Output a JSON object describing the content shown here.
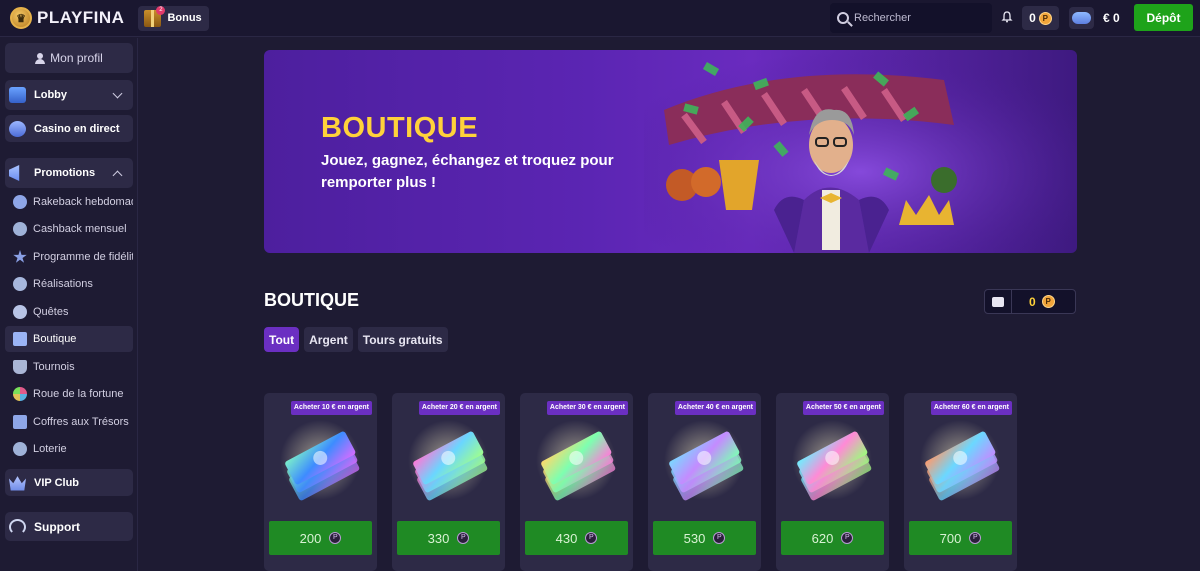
{
  "header": {
    "logo_text": "PLAYFINA",
    "bonus_label": "Bonus",
    "bonus_badge": "2",
    "search_placeholder": "Rechercher",
    "points": "0",
    "balance": "€ 0",
    "deposit_label": "Dépôt"
  },
  "sidebar": {
    "profile_label": "Mon profil",
    "lobby_label": "Lobby",
    "live_label": "Casino en direct",
    "promotions_label": "Promotions",
    "promo_items": [
      {
        "label": "Rakeback hebdomadaire",
        "icon": "percent-icon"
      },
      {
        "label": "Cashback mensuel",
        "icon": "cashback-icon"
      },
      {
        "label": "Programme de fidélité",
        "icon": "star-icon"
      },
      {
        "label": "Réalisations",
        "icon": "achievement-icon"
      },
      {
        "label": "Quêtes",
        "icon": "quest-icon"
      },
      {
        "label": "Boutique",
        "icon": "cart-icon"
      },
      {
        "label": "Tournois",
        "icon": "trophy-icon"
      },
      {
        "label": "Roue de la fortune",
        "icon": "wheel-icon"
      },
      {
        "label": "Coffres aux Trésors",
        "icon": "chest-icon"
      },
      {
        "label": "Loterie",
        "icon": "lottery-icon"
      }
    ],
    "vip_label": "VIP Club",
    "support_label": "Support"
  },
  "banner": {
    "title": "BOUTIQUE",
    "subtitle": "Jouez, gagnez, échangez et troquez pour remporter plus !"
  },
  "shop": {
    "title": "BOUTIQUE",
    "wallet_points": "0",
    "tabs": [
      "Tout",
      "Argent",
      "Tours gratuits"
    ],
    "active_tab": "Tout",
    "cards": [
      {
        "tag": "Acheter 10 € en argent",
        "price": "200"
      },
      {
        "tag": "Acheter 20 € en argent",
        "price": "330"
      },
      {
        "tag": "Acheter 30 € en argent",
        "price": "430"
      },
      {
        "tag": "Acheter 40 € en argent",
        "price": "530"
      },
      {
        "tag": "Acheter 50 € en argent",
        "price": "620"
      },
      {
        "tag": "Acheter 60 € en argent",
        "price": "700"
      }
    ]
  },
  "colors": {
    "accent_purple": "#6b2fc2",
    "brand_yellow": "#ffd23a",
    "cta_green": "#1ea31a",
    "price_green": "#1f8a24",
    "panel": "#2d2a46",
    "background": "#1e1b33"
  }
}
